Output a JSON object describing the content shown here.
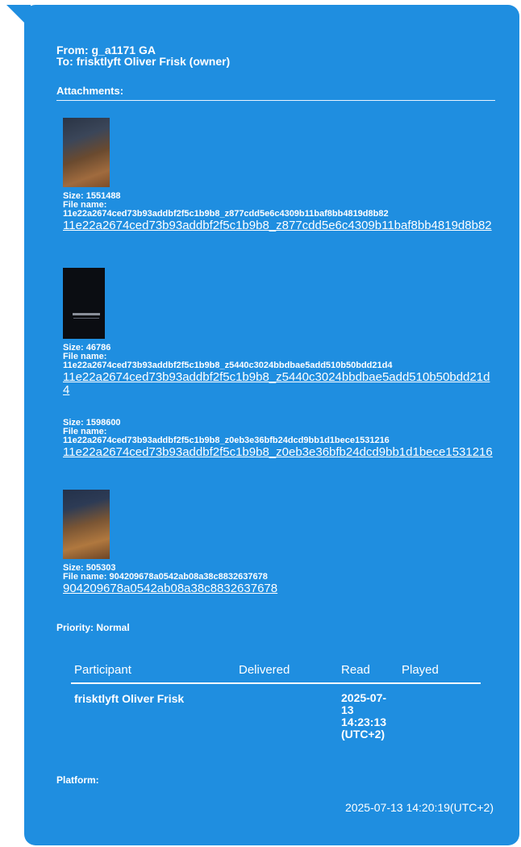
{
  "message": {
    "from": "From: g_a1171 GA",
    "to": "To: frisktlyft Oliver Frisk (owner)",
    "attachments_label": "Attachments:",
    "attachments": [
      {
        "thumb_icon": "image-thumbnail",
        "size": "Size: 1551488",
        "file_name_label": "File name:",
        "file_name": "11e22a2674ced73b93addbf2f5c1b9b8_z877cdd5e6c4309b11baf8bb4819d8b82",
        "link": "11e22a2674ced73b93addbf2f5c1b9b8_z877cdd5e6c4309b11baf8bb4819d8b82"
      },
      {
        "thumb_icon": "video-thumbnail",
        "size": "Size: 46786",
        "file_name_label": "File name:",
        "file_name": "11e22a2674ced73b93addbf2f5c1b9b8_z5440c3024bbdbae5add510b50bdd21d4",
        "link": "11e22a2674ced73b93addbf2f5c1b9b8_z5440c3024bbdbae5add510b50bdd21d4"
      },
      {
        "size": "Size: 1598600",
        "file_name_label": "File name:",
        "file_name": "11e22a2674ced73b93addbf2f5c1b9b8_z0eb3e36bfb24dcd9bb1d1bece1531216",
        "link": "11e22a2674ced73b93addbf2f5c1b9b8_z0eb3e36bfb24dcd9bb1d1bece1531216"
      },
      {
        "thumb_icon": "image-thumbnail",
        "size": "Size: 505303",
        "file_name_label": "File name:",
        "file_name": "904209678a0542ab08a38c8832637678",
        "link": "904209678a0542ab08a38c8832637678"
      }
    ],
    "priority": "Priority: Normal",
    "participants_table": {
      "headers": [
        "Participant",
        "Delivered",
        "Read",
        "Played"
      ],
      "rows": [
        {
          "participant": "frisktlyft Oliver Frisk",
          "delivered": "",
          "read": "2025-07-13 14:23:13 (UTC+2)",
          "played": ""
        }
      ]
    },
    "platform_label": "Platform:",
    "timestamp": "2025-07-13 14:20:19(UTC+2)",
    "colors": {
      "bubble": "#1f8ee0",
      "text": "#ffffff"
    }
  }
}
